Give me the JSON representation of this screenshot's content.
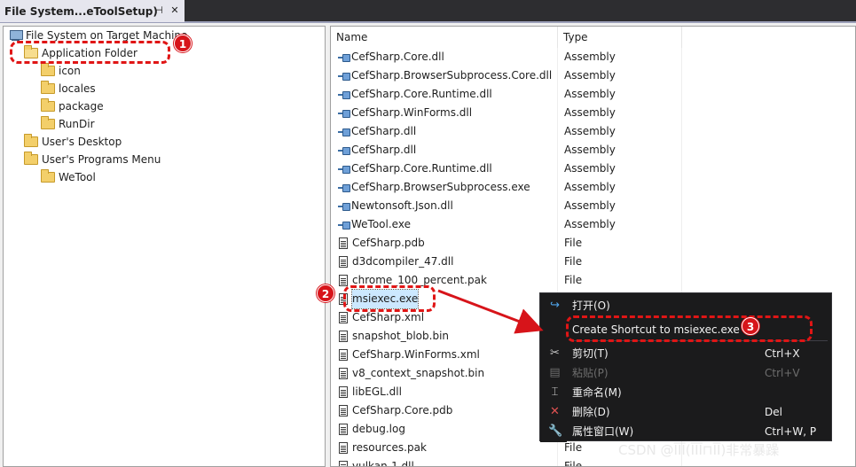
{
  "tab": {
    "title": "File System...eToolSetup)",
    "pin_glyph": "⊣",
    "close_glyph": "✕"
  },
  "tree": {
    "root": "File System on Target Machine",
    "items": [
      {
        "label": "Application Folder"
      },
      {
        "label": "icon"
      },
      {
        "label": "locales"
      },
      {
        "label": "package"
      },
      {
        "label": "RunDir"
      },
      {
        "label": "User's Desktop"
      },
      {
        "label": "User's Programs Menu"
      },
      {
        "label": "WeTool"
      }
    ]
  },
  "list": {
    "columns": [
      "Name",
      "Type"
    ],
    "rows": [
      {
        "name": "CefSharp.Core.dll",
        "type": "Assembly",
        "icon": "assembly-icon"
      },
      {
        "name": "CefSharp.BrowserSubprocess.Core.dll",
        "type": "Assembly",
        "icon": "assembly-icon"
      },
      {
        "name": "CefSharp.Core.Runtime.dll",
        "type": "Assembly",
        "icon": "assembly-icon"
      },
      {
        "name": "CefSharp.WinForms.dll",
        "type": "Assembly",
        "icon": "assembly-icon"
      },
      {
        "name": "CefSharp.dll",
        "type": "Assembly",
        "icon": "assembly-icon"
      },
      {
        "name": "CefSharp.dll",
        "type": "Assembly",
        "icon": "assembly-icon"
      },
      {
        "name": "CefSharp.Core.Runtime.dll",
        "type": "Assembly",
        "icon": "assembly-icon"
      },
      {
        "name": "CefSharp.BrowserSubprocess.exe",
        "type": "Assembly",
        "icon": "assembly-icon"
      },
      {
        "name": "Newtonsoft.Json.dll",
        "type": "Assembly",
        "icon": "assembly-icon"
      },
      {
        "name": "WeTool.exe",
        "type": "Assembly",
        "icon": "assembly-icon"
      },
      {
        "name": "CefSharp.pdb",
        "type": "File",
        "icon": "file-icon"
      },
      {
        "name": "d3dcompiler_47.dll",
        "type": "File",
        "icon": "file-icon"
      },
      {
        "name": "chrome_100_percent.pak",
        "type": "File",
        "icon": "file-icon"
      },
      {
        "name": "msiexec.exe",
        "type": "",
        "icon": "file-icon",
        "selected": true
      },
      {
        "name": "CefSharp.xml",
        "type": "",
        "icon": "file-icon"
      },
      {
        "name": "snapshot_blob.bin",
        "type": "",
        "icon": "file-icon"
      },
      {
        "name": "CefSharp.WinForms.xml",
        "type": "",
        "icon": "file-icon"
      },
      {
        "name": "v8_context_snapshot.bin",
        "type": "",
        "icon": "file-icon"
      },
      {
        "name": "libEGL.dll",
        "type": "",
        "icon": "file-icon"
      },
      {
        "name": "CefSharp.Core.pdb",
        "type": "",
        "icon": "file-icon"
      },
      {
        "name": "debug.log",
        "type": "",
        "icon": "file-icon"
      },
      {
        "name": "resources.pak",
        "type": "File",
        "icon": "file-icon"
      },
      {
        "name": "vulkan-1.dll",
        "type": "File",
        "icon": "file-icon"
      }
    ]
  },
  "context_menu": {
    "items": [
      {
        "label": "打开(O)",
        "shortcut": "",
        "icon": "open-icon",
        "glyph": "↪",
        "enabled": true
      },
      {
        "label": "Create Shortcut to msiexec.exe",
        "shortcut": "",
        "icon": "",
        "glyph": "",
        "enabled": true
      },
      {
        "label": "剪切(T)",
        "shortcut": "Ctrl+X",
        "icon": "scissors-icon",
        "glyph": "✂",
        "enabled": true
      },
      {
        "label": "粘贴(P)",
        "shortcut": "Ctrl+V",
        "icon": "paste-icon",
        "glyph": "▤",
        "enabled": false
      },
      {
        "label": "重命名(M)",
        "shortcut": "",
        "icon": "rename-icon",
        "glyph": "⌶",
        "enabled": true
      },
      {
        "label": "删除(D)",
        "shortcut": "Del",
        "icon": "delete-icon",
        "glyph": "✕",
        "enabled": true
      },
      {
        "label": "属性窗口(W)",
        "shortcut": "Ctrl+W, P",
        "icon": "wrench-icon",
        "glyph": "🔧",
        "enabled": true
      }
    ]
  },
  "annotations": {
    "badge1": "1",
    "badge2": "2",
    "badge3": "3",
    "accent": "#d7141a"
  },
  "watermark": "CSDN @ĪĪĪ(ĪĪĪ⊓ĪĪ)非常暴躁"
}
